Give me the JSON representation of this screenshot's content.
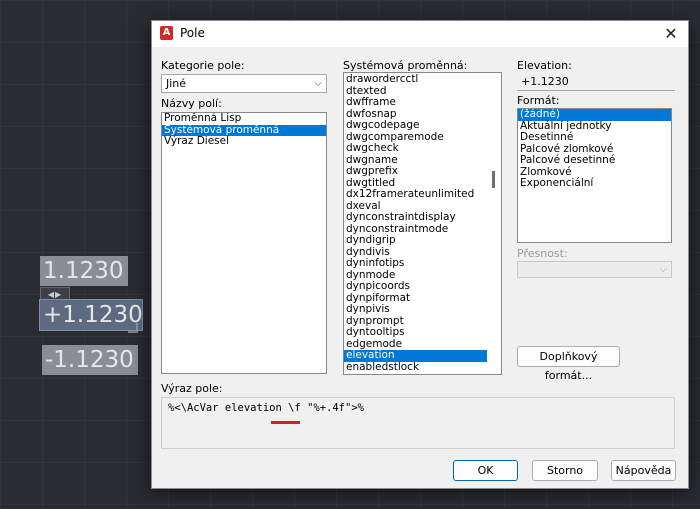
{
  "canvas": {
    "texts": [
      "1.1230",
      "+1.1230",
      "-1.1230"
    ],
    "grip_glyph": "◀▶"
  },
  "dialog": {
    "title": "Pole",
    "app_icon_letter": "A",
    "close_glyph": "✕",
    "field_category_label": "Kategorie pole:",
    "field_category_value": "Jiné",
    "field_names_label": "Názvy polí:",
    "field_names": [
      {
        "label": "Proměnná Lisp",
        "selected": false
      },
      {
        "label": "Systémová proměnná",
        "selected": true
      },
      {
        "label": "Výraz Diesel",
        "selected": false
      }
    ],
    "sysvar_label": "Systémová proměnná:",
    "sysvars": [
      "drawordercctl",
      "dtexted",
      "dwfframe",
      "dwfosnap",
      "dwgcodepage",
      "dwgcomparemode",
      "dwgcheck",
      "dwgname",
      "dwgprefix",
      "dwgtitled",
      "dx12framerateunlimited",
      "dxeval",
      "dynconstraintdisplay",
      "dynconstraintmode",
      "dyndigrip",
      "dyndivis",
      "dyninfotips",
      "dynmode",
      "dynpicoords",
      "dynpiformat",
      "dynpivis",
      "dynprompt",
      "dyntooltips",
      "edgemode",
      "elevation",
      "enabledstlock"
    ],
    "sysvar_selected": "elevation",
    "elevation_label": "Elevation:",
    "elevation_value": "+1.1230",
    "format_label": "Formát:",
    "formats": [
      {
        "label": "(žádné)",
        "selected": true
      },
      {
        "label": "Aktuální jednotky",
        "selected": false
      },
      {
        "label": "Desetinné",
        "selected": false
      },
      {
        "label": "Palcové zlomkové",
        "selected": false
      },
      {
        "label": "Palcové desetinné",
        "selected": false
      },
      {
        "label": "Zlomkové",
        "selected": false
      },
      {
        "label": "Exponenciální",
        "selected": false
      }
    ],
    "precision_label": "Přesnost:",
    "extra_format_button": "Doplňkový formát...",
    "expression_label": "Výraz pole:",
    "expression_value": "%<\\AcVar elevation \\f \"%+.4f\">%",
    "ok_button": "OK",
    "cancel_button": "Storno",
    "help_button": "Nápověda"
  },
  "colors": {
    "selection": "#0078d7",
    "highlight_underline": "#e01e1e",
    "app_icon": "#d3282a"
  }
}
